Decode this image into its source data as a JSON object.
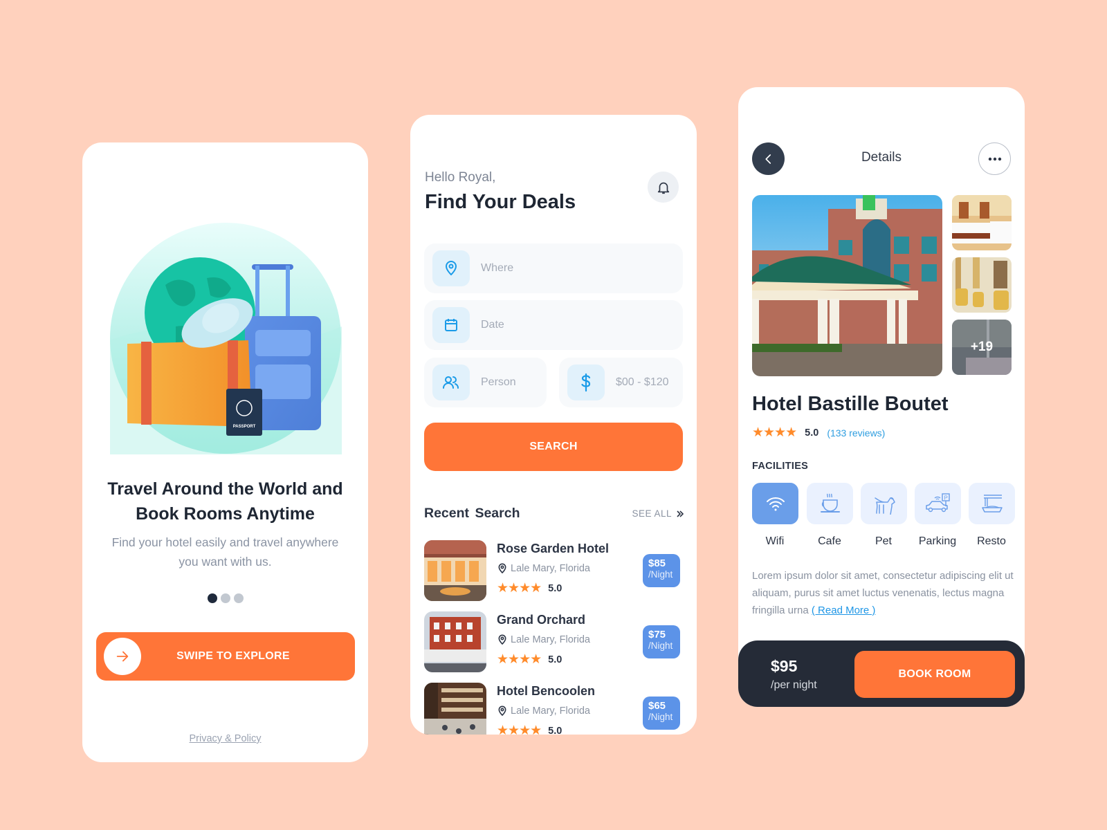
{
  "onboarding": {
    "title_line1": "Travel Around the World and",
    "title_line2": "Book Rooms Anytime",
    "subtitle_line1": "Find your hotel easily and travel anywhere",
    "subtitle_line2": "you want with us.",
    "pagination": {
      "total": 3,
      "active": 1
    },
    "swipe_label": "SWIPE TO EXPLORE",
    "privacy_link": "Privacy & Policy",
    "passport_text": "PASSPORT"
  },
  "search": {
    "greeting": "Hello Royal,",
    "title": "Find Your Deals",
    "fields": {
      "where": {
        "placeholder": "Where",
        "icon": "map-pin-icon"
      },
      "date": {
        "placeholder": "Date",
        "icon": "calendar-icon"
      },
      "person": {
        "placeholder": "Person",
        "icon": "users-icon"
      },
      "price": {
        "placeholder": "$00 - $120",
        "icon": "dollar-icon"
      }
    },
    "search_label": "SEARCH",
    "recent_title": "Recent  Search",
    "see_all": "SEE ALL",
    "hotels": [
      {
        "name": "Rose Garden Hotel",
        "location": "Lale Mary, Florida",
        "stars": 4,
        "rating": "5.0",
        "price": "$85",
        "per": "/Night"
      },
      {
        "name": "Grand Orchard",
        "location": "Lale Mary, Florida",
        "stars": 4,
        "rating": "5.0",
        "price": "$75",
        "per": "/Night"
      },
      {
        "name": "Hotel Bencoolen",
        "location": "Lale Mary, Florida",
        "stars": 4,
        "rating": "5.0",
        "price": "$65",
        "per": "/Night"
      }
    ]
  },
  "details": {
    "header_title": "Details",
    "more_photos": "+19",
    "hotel_name": "Hotel Bastille Boutet",
    "stars": 4,
    "rating": "5.0",
    "reviews": "(133 reviews)",
    "facilities_label": "FACILITIES",
    "facilities": [
      {
        "name": "Wifi",
        "icon": "wifi-icon",
        "active": true
      },
      {
        "name": "Cafe",
        "icon": "coffee-cup-icon",
        "active": false
      },
      {
        "name": "Pet",
        "icon": "dog-icon",
        "active": false
      },
      {
        "name": "Parking",
        "icon": "car-parking-icon",
        "active": false
      },
      {
        "name": "Resto",
        "icon": "noodles-icon",
        "active": false
      }
    ],
    "description": "Lorem ipsum dolor sit amet, consectetur adipiscing elit ut aliquam, purus sit amet luctus venenatis, lectus magna fringilla urna ",
    "read_more": "( Read More )",
    "price": "$95",
    "per_night": "/per night",
    "book_label": "BOOK ROOM"
  },
  "colors": {
    "background": "#ffd1bd",
    "accent": "#ff7538",
    "dark": "#252b37",
    "blue": "#5c93e8",
    "star": "#ff8b2b",
    "link": "#1e96e6"
  }
}
